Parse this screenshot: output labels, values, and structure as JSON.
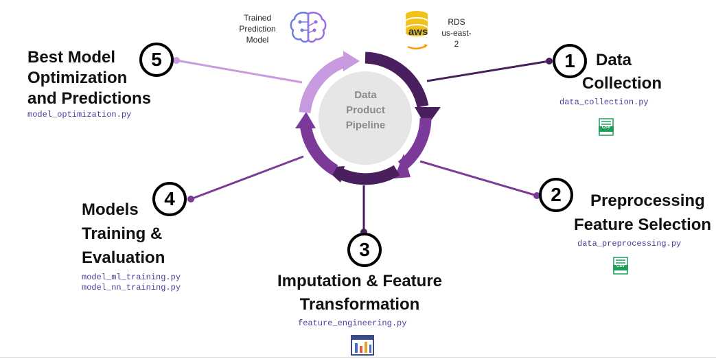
{
  "center": {
    "lines": [
      "Data",
      "Product",
      "Pipeline"
    ]
  },
  "steps": [
    {
      "number": "1",
      "title_lines": [
        "Data",
        "Collection"
      ],
      "files": [
        "data_collection.py"
      ]
    },
    {
      "number": "2",
      "title_lines": [
        "Preprocessing",
        "Feature Selection"
      ],
      "files": [
        "data_preprocessing.py"
      ]
    },
    {
      "number": "3",
      "title_lines": [
        "Imputation & Feature",
        "Transformation"
      ],
      "files": [
        "feature_engineering.py"
      ]
    },
    {
      "number": "4",
      "title_lines": [
        "Models",
        "Training &",
        "Evaluation"
      ],
      "files": [
        "model_ml_training.py",
        "model_nn_training.py"
      ]
    },
    {
      "number": "5",
      "title_lines": [
        "Best Model",
        "Optimization",
        "and Predictions"
      ],
      "files": [
        "model_optimization.py"
      ]
    }
  ],
  "top": {
    "model_label": [
      "Trained",
      "Prediction",
      "Model"
    ],
    "rds_label": [
      "RDS",
      "us-east-2"
    ],
    "aws_logo_text": "aws"
  },
  "badges": {
    "csv_1": "CSV",
    "csv_2": "CSV"
  },
  "icons": {
    "brain": "brain-circuit-icon",
    "database": "aws-database-icon",
    "csv": "csv-file-icon",
    "table": "table-chart-icon"
  },
  "colors": {
    "dark_purple": "#4a1f5e",
    "mid_purple": "#7b3a9a",
    "light_purple": "#c89be0",
    "number_circle": "#000000",
    "file_text": "#4b3a9a",
    "csv_green": "#1e9e5a",
    "aws_orange": "#ff9900",
    "db_yellow": "#f2c21a",
    "center_grey": "#e6e6e6"
  }
}
